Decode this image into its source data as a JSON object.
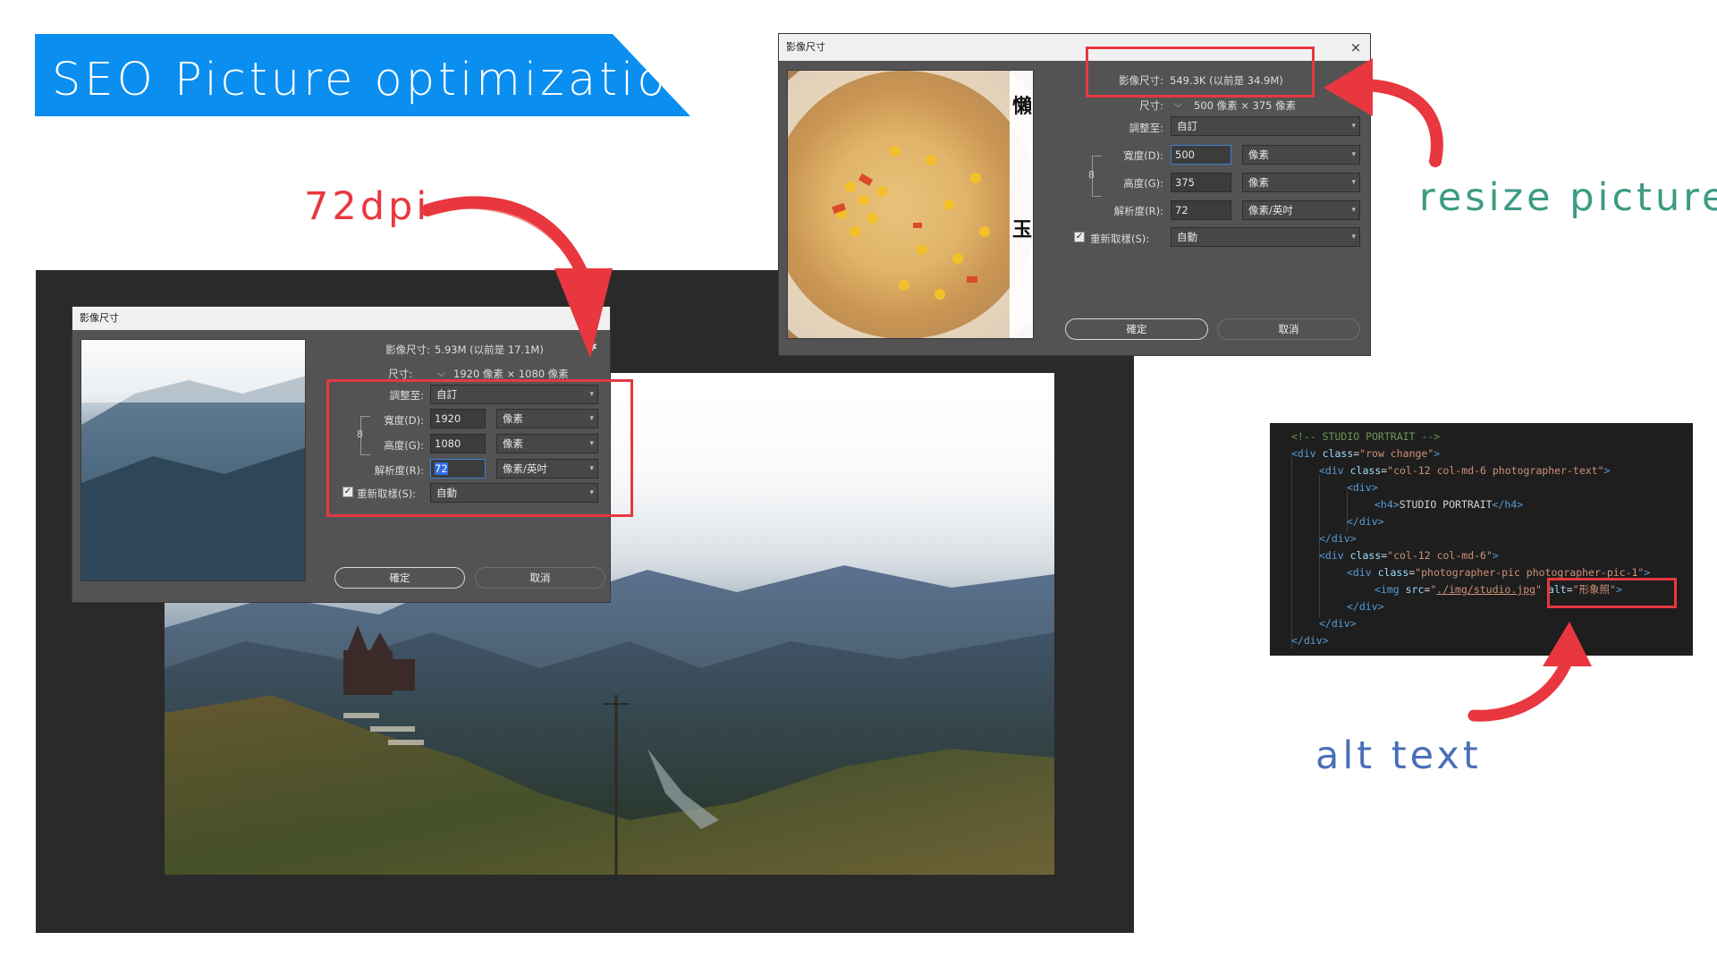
{
  "banner": {
    "title": "SEO Picture optimization"
  },
  "captions": {
    "dpi": "72dpi",
    "resize": "resize picture",
    "alt": "alt text"
  },
  "dialog_left": {
    "title": "影像尺寸",
    "close": "×",
    "image_size_label": "影像尺寸:",
    "image_size_value": "5.93M (以前是 17.1M)",
    "dimensions_label": "尺寸:",
    "dimensions_value": "1920 像素 × 1080 像素",
    "fit_to_label": "調整至:",
    "fit_to_value": "自訂",
    "width_label": "寬度(D):",
    "width_value": "1920",
    "width_unit": "像素",
    "height_label": "高度(G):",
    "height_value": "1080",
    "height_unit": "像素",
    "resolution_label": "解析度(R):",
    "resolution_value": "72",
    "resolution_unit": "像素/英吋",
    "resample_label": "重新取樣(S):",
    "resample_value": "自動",
    "resample_checked": true,
    "ok_label": "確定",
    "cancel_label": "取消"
  },
  "dialog_right": {
    "title": "影像尺寸",
    "close": "×",
    "image_size_label": "影像尺寸:",
    "image_size_value": "549.3K (以前是 34.9M)",
    "dimensions_label": "尺寸:",
    "dimensions_value": "500 像素 × 375 像素",
    "fit_to_label": "調整至:",
    "fit_to_value": "自訂",
    "width_label": "寬度(D):",
    "width_value": "500",
    "width_unit": "像素",
    "height_label": "高度(G):",
    "height_value": "375",
    "height_unit": "像素",
    "resolution_label": "解析度(R):",
    "resolution_value": "72",
    "resolution_unit": "像素/英吋",
    "resample_label": "重新取樣(S):",
    "resample_value": "自動",
    "resample_checked": true,
    "ok_label": "確定",
    "cancel_label": "取消",
    "preview_overlay_text": [
      "懶",
      "玉"
    ]
  },
  "code": {
    "lines": [
      {
        "indent": 0,
        "parts": [
          {
            "t": "comment",
            "v": "<!-- STUDIO PORTRAIT -->"
          }
        ]
      },
      {
        "indent": 0,
        "parts": [
          {
            "t": "tag",
            "v": "<div "
          },
          {
            "t": "attr",
            "v": "class"
          },
          {
            "t": "text",
            "v": "="
          },
          {
            "t": "str",
            "v": "\"row change\""
          },
          {
            "t": "tag",
            "v": ">"
          }
        ]
      },
      {
        "indent": 1,
        "parts": [
          {
            "t": "tag",
            "v": "<div "
          },
          {
            "t": "attr",
            "v": "class"
          },
          {
            "t": "text",
            "v": "="
          },
          {
            "t": "str",
            "v": "\"col-12 col-md-6 photographer-text\""
          },
          {
            "t": "tag",
            "v": ">"
          }
        ]
      },
      {
        "indent": 2,
        "parts": [
          {
            "t": "tag",
            "v": "<div>"
          }
        ]
      },
      {
        "indent": 3,
        "parts": [
          {
            "t": "tag",
            "v": "<h4>"
          },
          {
            "t": "text",
            "v": "STUDIO PORTRAIT"
          },
          {
            "t": "tag",
            "v": "</h4>"
          }
        ]
      },
      {
        "indent": 2,
        "parts": [
          {
            "t": "tag",
            "v": "</div>"
          }
        ]
      },
      {
        "indent": 1,
        "parts": [
          {
            "t": "tag",
            "v": "</div>"
          }
        ]
      },
      {
        "indent": 1,
        "parts": [
          {
            "t": "tag",
            "v": "<div "
          },
          {
            "t": "attr",
            "v": "class"
          },
          {
            "t": "text",
            "v": "="
          },
          {
            "t": "str",
            "v": "\"col-12 col-md-6\""
          },
          {
            "t": "tag",
            "v": ">"
          }
        ]
      },
      {
        "indent": 2,
        "parts": [
          {
            "t": "tag",
            "v": "<div "
          },
          {
            "t": "attr",
            "v": "class"
          },
          {
            "t": "text",
            "v": "="
          },
          {
            "t": "str",
            "v": "\"photographer-pic photographer-pic-1\""
          },
          {
            "t": "tag",
            "v": ">"
          }
        ]
      },
      {
        "indent": 3,
        "parts": [
          {
            "t": "tag",
            "v": "<img "
          },
          {
            "t": "attr",
            "v": "src"
          },
          {
            "t": "text",
            "v": "="
          },
          {
            "t": "str",
            "v": "\""
          },
          {
            "t": "link",
            "v": "./img/studio.jpg"
          },
          {
            "t": "str",
            "v": "\""
          },
          {
            "t": "text",
            "v": " "
          },
          {
            "t": "attr",
            "v": "alt"
          },
          {
            "t": "text",
            "v": "="
          },
          {
            "t": "str",
            "v": "\"形象照\""
          },
          {
            "t": "tag",
            "v": ">"
          }
        ]
      },
      {
        "indent": 2,
        "parts": [
          {
            "t": "tag",
            "v": "</div>"
          }
        ]
      },
      {
        "indent": 1,
        "parts": [
          {
            "t": "tag",
            "v": "</div>"
          }
        ]
      },
      {
        "indent": 0,
        "parts": [
          {
            "t": "tag",
            "v": "</div>"
          }
        ]
      }
    ]
  },
  "colors": {
    "banner": "#0a8ef0",
    "highlight_red": "#e8373f",
    "caption_green": "#3c9b84",
    "caption_blue": "#4a6fb8",
    "dialog_bg": "#535353",
    "code_bg": "#1e1e1e"
  }
}
